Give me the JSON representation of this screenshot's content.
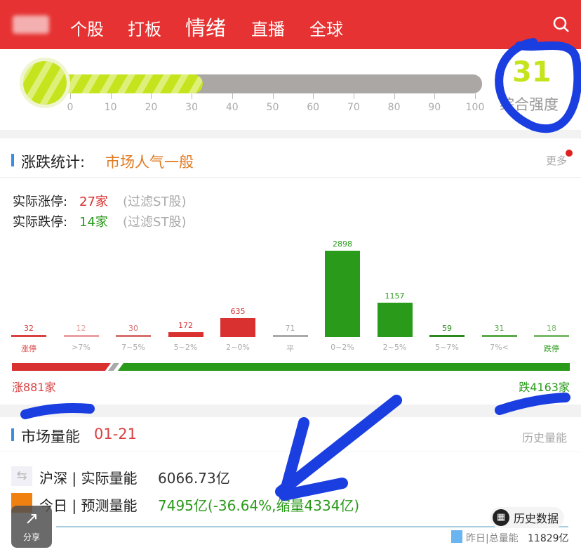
{
  "header": {
    "tabs": [
      {
        "label": "个股"
      },
      {
        "label": "打板"
      },
      {
        "label": "情绪",
        "active": true
      },
      {
        "label": "直播"
      },
      {
        "label": "全球"
      }
    ],
    "search_icon": "search-icon",
    "color": "#e63232"
  },
  "gauge": {
    "value": 31,
    "value_text": "31",
    "label": "综合强度",
    "ticks": [
      "0",
      "10",
      "20",
      "30",
      "40",
      "50",
      "60",
      "70",
      "80",
      "90",
      "100"
    ],
    "fill_color": "#c6e41e"
  },
  "stats": {
    "title": "涨跌统计:",
    "mood": "市场人气一般",
    "more": "更多",
    "limit_up_label": "实际涨停:",
    "limit_up": "27家",
    "limit_down_label": "实际跌停:",
    "limit_down": "14家",
    "filter_note": "(过滤ST股)",
    "up_total": "涨881家",
    "down_total": "跌4163家"
  },
  "chart_data": {
    "type": "bar",
    "categories": [
      "涨停",
      ">7%",
      "7~5%",
      "5~2%",
      "2~0%",
      "平",
      "0~2%",
      "2~5%",
      "5~7%",
      "7%<",
      "跌停"
    ],
    "values": [
      32,
      12,
      30,
      172,
      635,
      71,
      2898,
      1157,
      59,
      31,
      18
    ],
    "colors": [
      "#d94040",
      "#e8a0a0",
      "#d97070",
      "#d93030",
      "#d93030",
      "#aaaaaa",
      "#2a9a1a",
      "#2a9a1a",
      "#2a8a1a",
      "#5aaa4a",
      "#7aba6a"
    ],
    "up": 881,
    "flat": 71,
    "down": 4163
  },
  "volume": {
    "title": "市场量能",
    "date": "01-21",
    "history": "历史量能",
    "row1_label": "沪深 | 实际量能",
    "row1_value": "6066.73亿",
    "row2_label": "今日 | 预测量能",
    "row2_value": "7495亿(-36.64%,缩量4334亿)",
    "history_data": "历史数据",
    "legend": "昨日|总量能",
    "legend_value": "11829亿",
    "share": "分享"
  }
}
